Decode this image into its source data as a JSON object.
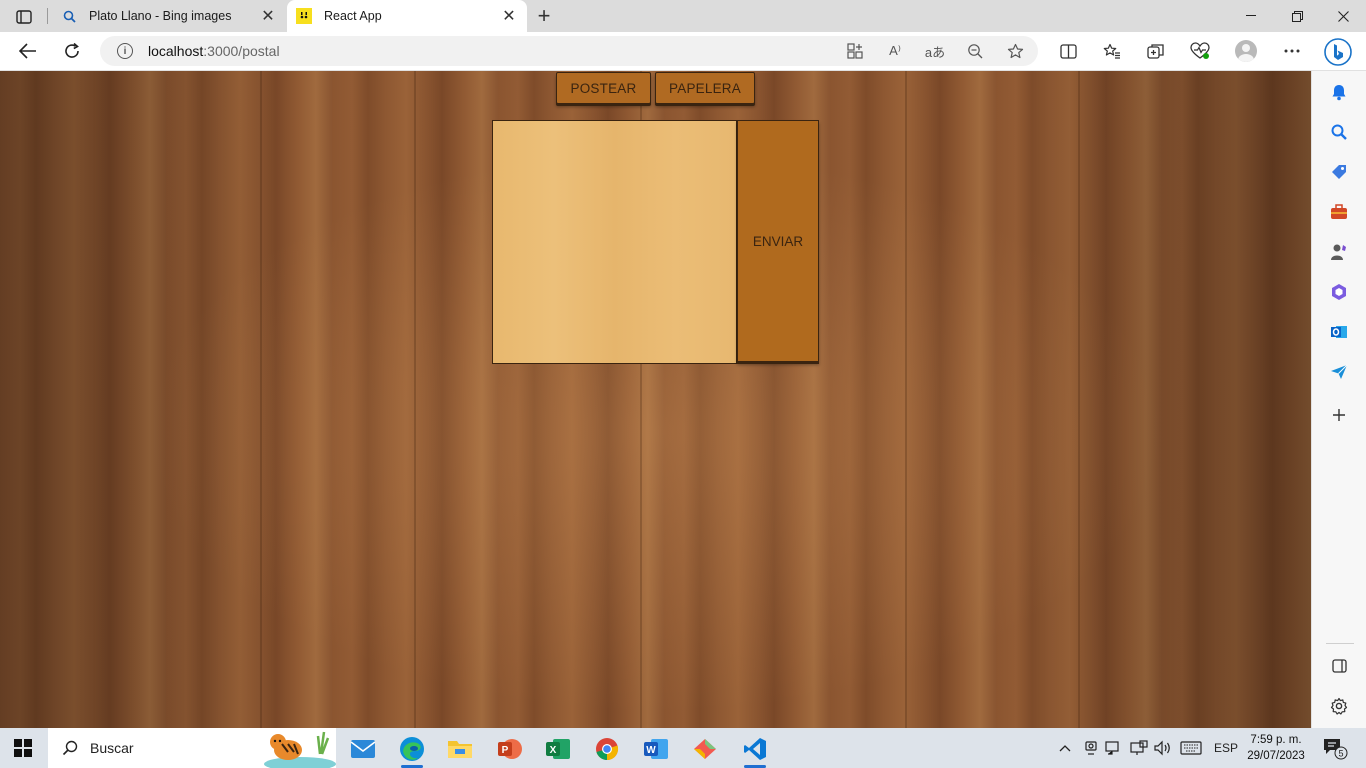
{
  "browser": {
    "tabs": [
      {
        "title": "Plato Llano - Bing images",
        "favicon": "search-icon",
        "active": false
      },
      {
        "title": "React App",
        "favicon": "react-app-icon",
        "active": true
      }
    ],
    "address": {
      "host": "localhost",
      "path": ":3000/postal"
    }
  },
  "app": {
    "buttons": {
      "post": "POSTEAR",
      "trash": "PAPELERA",
      "send": "ENVIAR"
    },
    "colors": {
      "button": "#b06a22",
      "note": "#e8b86e",
      "border": "#3a2410"
    }
  },
  "taskbar": {
    "search_label": "Buscar",
    "language": "ESP",
    "time": "7:59 p. m.",
    "date": "29/07/2023",
    "notification_count": "5"
  }
}
